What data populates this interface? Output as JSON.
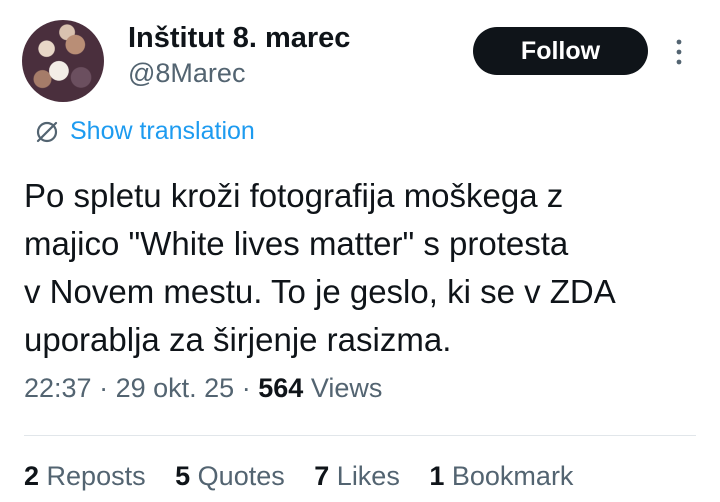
{
  "author": {
    "display_name": "Inštitut 8. marec",
    "handle": "@8Marec"
  },
  "follow_label": "Follow",
  "translate_label": "Show translation",
  "tweet_lines": [
    "Po spletu kroži fotografija moškega z",
    "majico \"White lives matter\" s protesta",
    "v Novem mestu. To je geslo, ki se v ZDA",
    "uporablja za širjenje rasizma."
  ],
  "meta": {
    "time": "22:37",
    "date": "29 okt. 25",
    "views_count": "564",
    "views_label": "Views",
    "separator": "·"
  },
  "stats": {
    "reposts_count": "2",
    "reposts_label": "Reposts",
    "quotes_count": "5",
    "quotes_label": "Quotes",
    "likes_count": "7",
    "likes_label": "Likes",
    "bookmarks_count": "1",
    "bookmarks_label": "Bookmark"
  },
  "colors": {
    "accent": "#1d9bf0",
    "text": "#0f1419",
    "muted": "#536471",
    "button_bg": "#0f1419"
  },
  "icons": [
    "more-vertical-icon",
    "translate-icon"
  ]
}
